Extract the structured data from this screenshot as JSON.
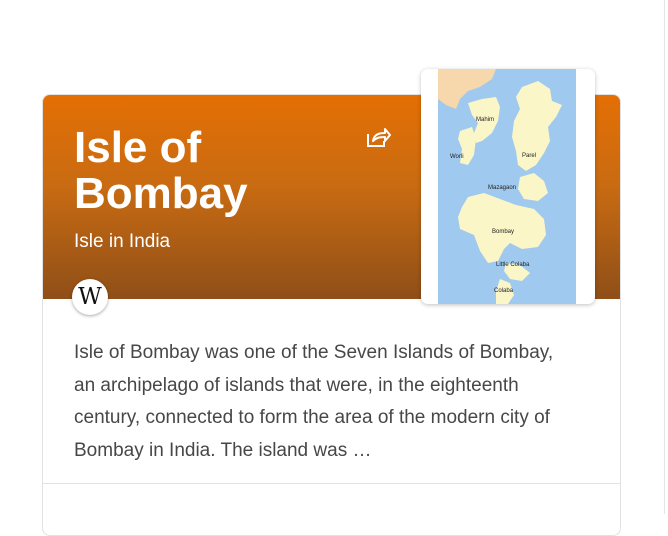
{
  "card": {
    "title": "Isle of Bombay",
    "subtitle": "Isle in India",
    "source_icon": "W",
    "description": "Isle of Bombay was one of the Seven Islands of Bombay, an archipelago of islands that were, in the eighteenth century, connected to form the area of the modern city of Bombay in India. The island was …",
    "share_icon": "share-icon"
  },
  "map": {
    "labels": {
      "mahim": "Mahim",
      "worli": "Worli",
      "parel": "Parel",
      "mazagaon": "Mazagaon",
      "bombay": "Bombay",
      "little_colaba": "Little Colaba",
      "colaba": "Colaba"
    },
    "colors": {
      "sea": "#9fc9ee",
      "land": "#fbf6c8",
      "mainland": "#f7d7ac"
    }
  },
  "colors": {
    "header_top": "#e46f04",
    "header_bottom": "#8f4f18"
  }
}
